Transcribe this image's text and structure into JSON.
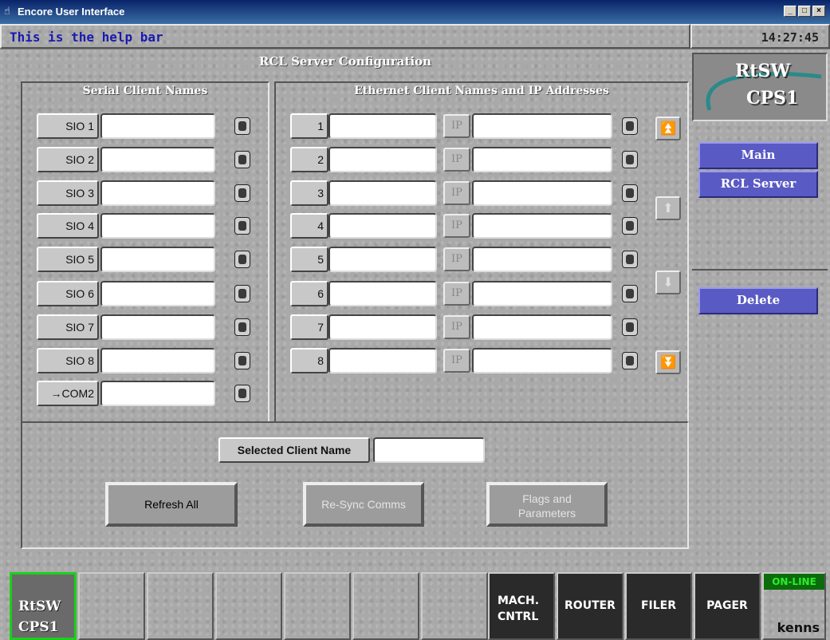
{
  "window": {
    "title": "Encore User Interface",
    "controls": [
      "_",
      "□",
      "×"
    ]
  },
  "helpbar": {
    "text": "This is the help bar"
  },
  "clock": {
    "time": "14:27:45"
  },
  "main": {
    "title": "RCL Server Configuration",
    "serial": {
      "title": "Serial Client Names",
      "rows": [
        {
          "label": "SIO 1",
          "value": ""
        },
        {
          "label": "SIO 2",
          "value": ""
        },
        {
          "label": "SIO 3",
          "value": ""
        },
        {
          "label": "SIO 4",
          "value": ""
        },
        {
          "label": "SIO 5",
          "value": ""
        },
        {
          "label": "SIO 6",
          "value": ""
        },
        {
          "label": "SIO 7",
          "value": ""
        },
        {
          "label": "SIO 8",
          "value": ""
        },
        {
          "label": "→COM2",
          "value": ""
        }
      ]
    },
    "ethernet": {
      "title": "Ethernet Client Names and IP Addresses",
      "ip_label": "IP",
      "rows": [
        {
          "label": "1",
          "name": "",
          "ip": ""
        },
        {
          "label": "2",
          "name": "",
          "ip": ""
        },
        {
          "label": "3",
          "name": "",
          "ip": ""
        },
        {
          "label": "4",
          "name": "",
          "ip": ""
        },
        {
          "label": "5",
          "name": "",
          "ip": ""
        },
        {
          "label": "6",
          "name": "",
          "ip": ""
        },
        {
          "label": "7",
          "name": "",
          "ip": ""
        },
        {
          "label": "8",
          "name": "",
          "ip": ""
        }
      ]
    },
    "selected_client": {
      "label": "Selected Client Name",
      "value": ""
    },
    "buttons": {
      "refresh": "Refresh All",
      "resync": "Re-Sync Comms",
      "flags_1": "Flags and",
      "flags_2": "Parameters"
    }
  },
  "right": {
    "logo_top": "RtSW",
    "logo_bottom": "CPS1",
    "main_button": "Main",
    "rcl_button": "RCL Server",
    "delete_button": "Delete"
  },
  "bottom": {
    "home_1": "RtSW",
    "home_2": "CPS1",
    "mach_1": "MACH.",
    "mach_2": "CNTRL",
    "router": "ROUTER",
    "filer": "FILER",
    "pager": "PAGER",
    "status": "ON-LINE",
    "user": "kenns"
  }
}
